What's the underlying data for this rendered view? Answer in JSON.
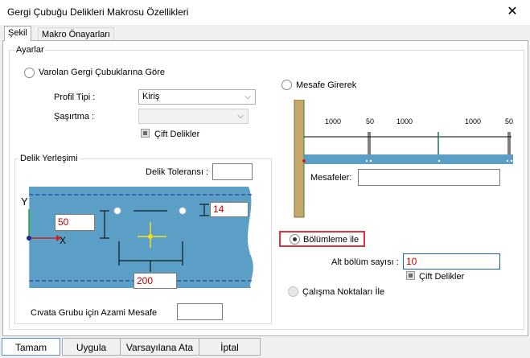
{
  "window": {
    "title": "Gergi Çubuğu Delikleri Makrosu Özellikleri"
  },
  "tabs": [
    {
      "label": "Şekil",
      "active": true
    },
    {
      "label": "Makro Önayarları",
      "active": false
    }
  ],
  "settings_group": {
    "label": "Ayarlar"
  },
  "existing_rods": {
    "radio_label": "Varolan Gergi Çubuklarına Göre",
    "profile_type_label": "Profil Tipi :",
    "profile_type_value": "Kiriş",
    "stagger_label": "Şaşırtma :",
    "stagger_value": "",
    "double_holes_label": "Çift Delikler"
  },
  "hole_placement": {
    "label": "Delik Yerleşimi",
    "tolerance_label": "Delik Toleransı :",
    "tolerance_value": "",
    "axis_y": "Y",
    "axis_x": "X",
    "value_50": "50",
    "value_14": "14",
    "value_200": "200",
    "max_distance_label": "Cıvata Grubu için Azami Mesafe",
    "max_distance_value": ""
  },
  "distance_mode": {
    "radio_label": "Mesafe Girerek",
    "dims": [
      "1000",
      "50",
      "1000",
      "1000",
      "50"
    ],
    "distances_label": "Mesafeler:",
    "distances_value": ""
  },
  "division_mode": {
    "radio_label": "Bölümleme ile",
    "sub_count_label": "Alt bölüm sayısı :",
    "sub_count_value": "10",
    "double_holes_label": "Çift Delikler"
  },
  "work_points": {
    "radio_label": "Çalışma Noktaları İle"
  },
  "buttons": {
    "ok": "Tamam",
    "apply": "Uygula",
    "defaults": "Varsayılana Ata",
    "cancel": "İptal"
  },
  "colors": {
    "highlight": "#d9363e",
    "plate": "#5b9ec6",
    "accent_red": "#c00000",
    "selection_border": "#1c5fb6"
  },
  "icons": {
    "close": "close-icon",
    "chevron": "chevron-down-icon"
  }
}
